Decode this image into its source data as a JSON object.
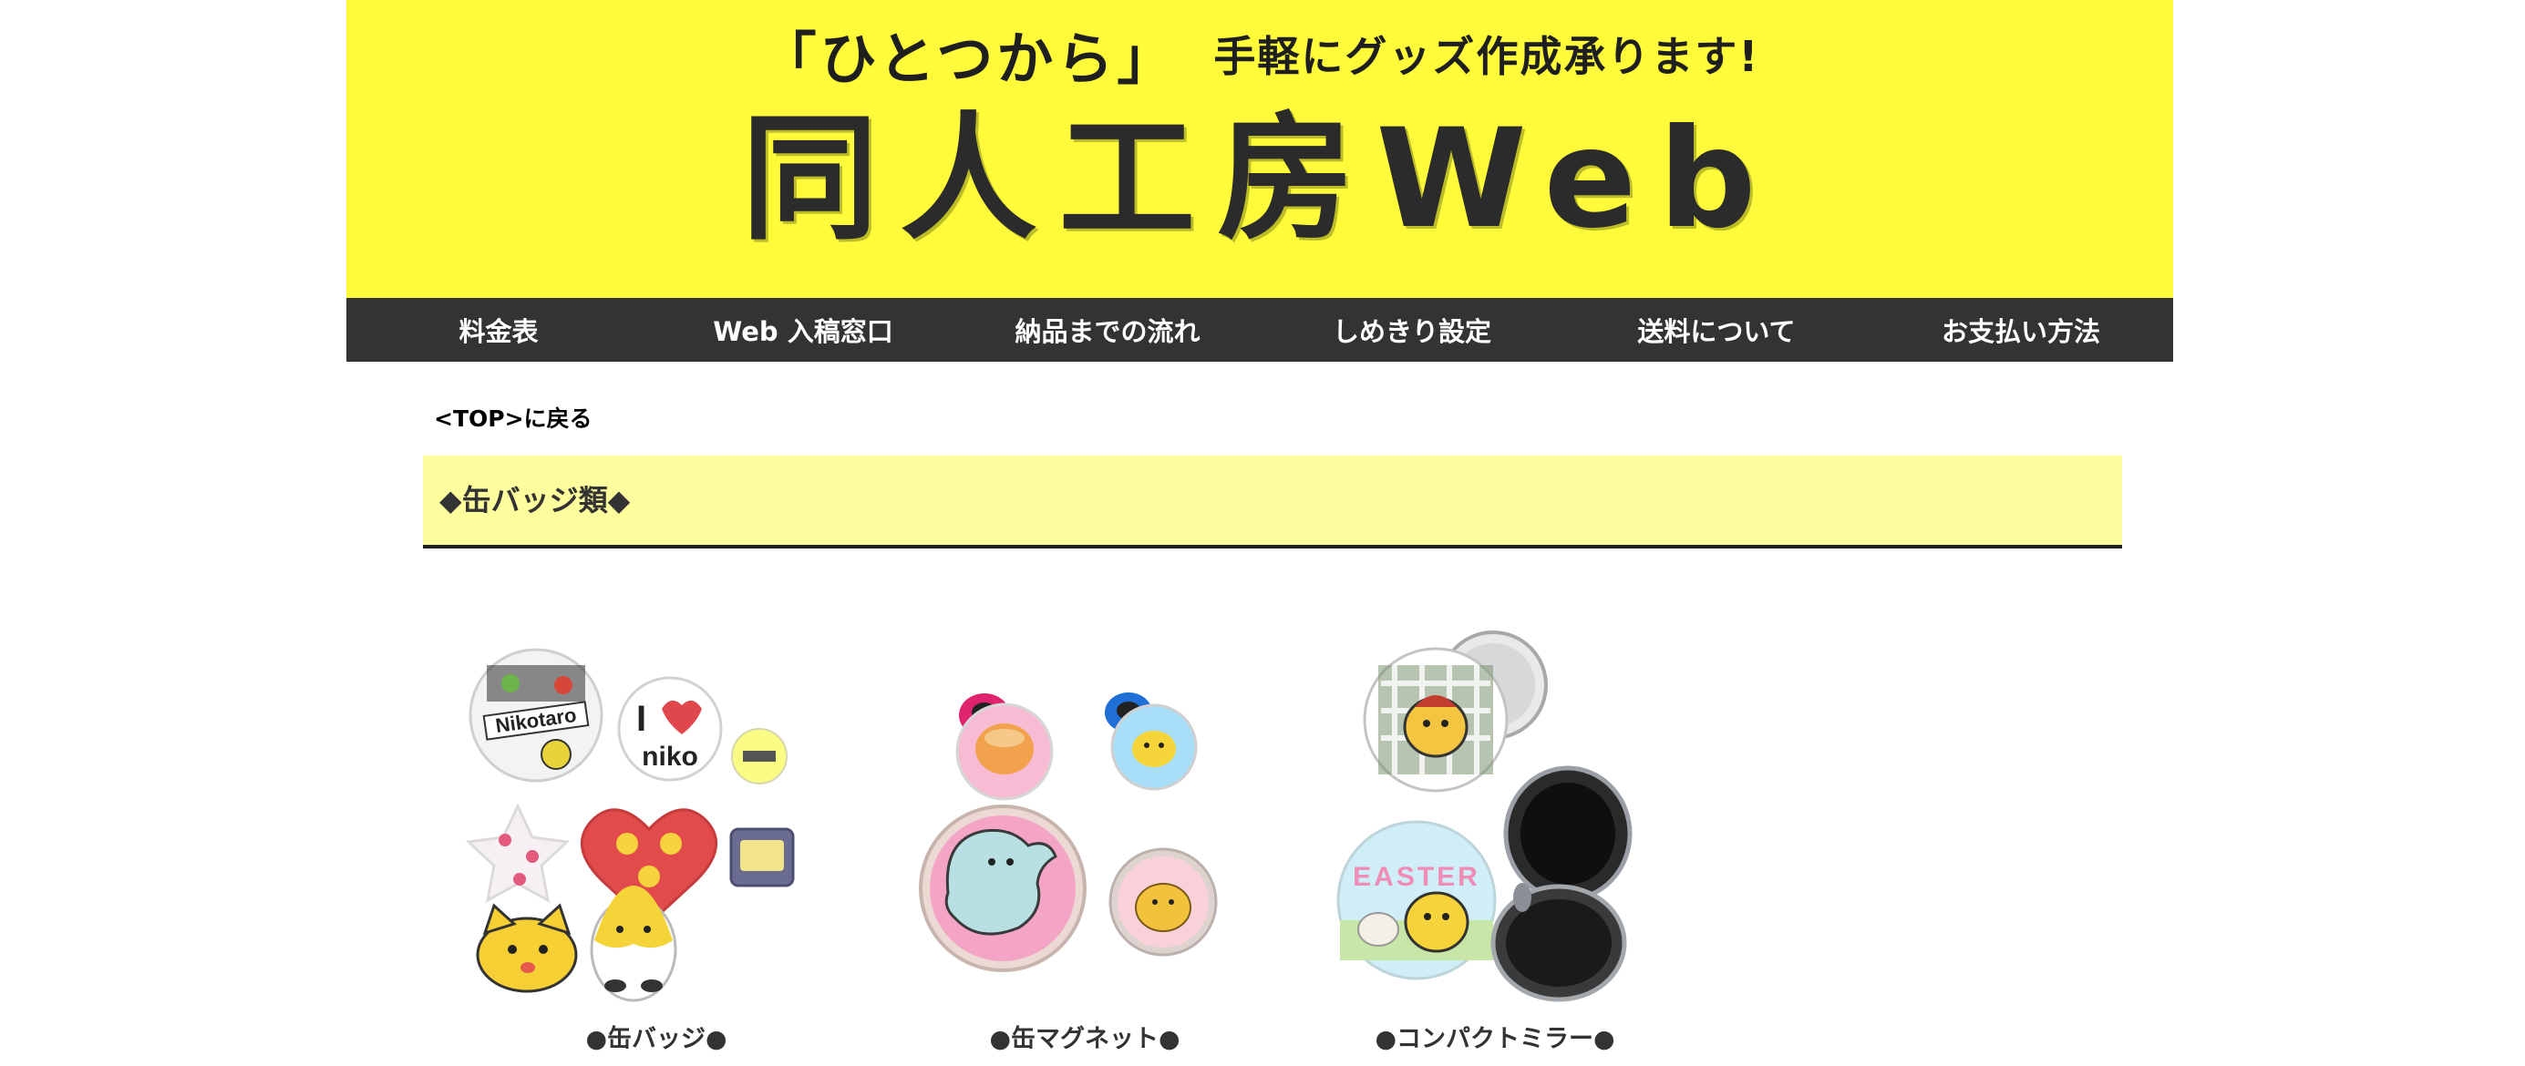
{
  "header": {
    "tagline_bracket": "「ひとつから」",
    "tagline_rest": "手軽にグッズ作成承ります!",
    "site_title": "同人工房Web"
  },
  "nav": {
    "items": [
      {
        "label": "料金表"
      },
      {
        "label": "Web 入稿窓口"
      },
      {
        "label": "納品までの流れ"
      },
      {
        "label": "しめきり設定"
      },
      {
        "label": "送料について"
      },
      {
        "label": "お支払い方法"
      }
    ]
  },
  "back_link": "<TOP>に戻る",
  "section_title": "◆缶バッジ類◆",
  "products": [
    {
      "caption": "●缶バッジ●"
    },
    {
      "caption": "●缶マグネット●"
    },
    {
      "caption": "●コンパクトミラー●"
    }
  ],
  "colors": {
    "banner": "#fffb3b",
    "nav": "#333333",
    "section_bg": "#fdfd9d"
  }
}
